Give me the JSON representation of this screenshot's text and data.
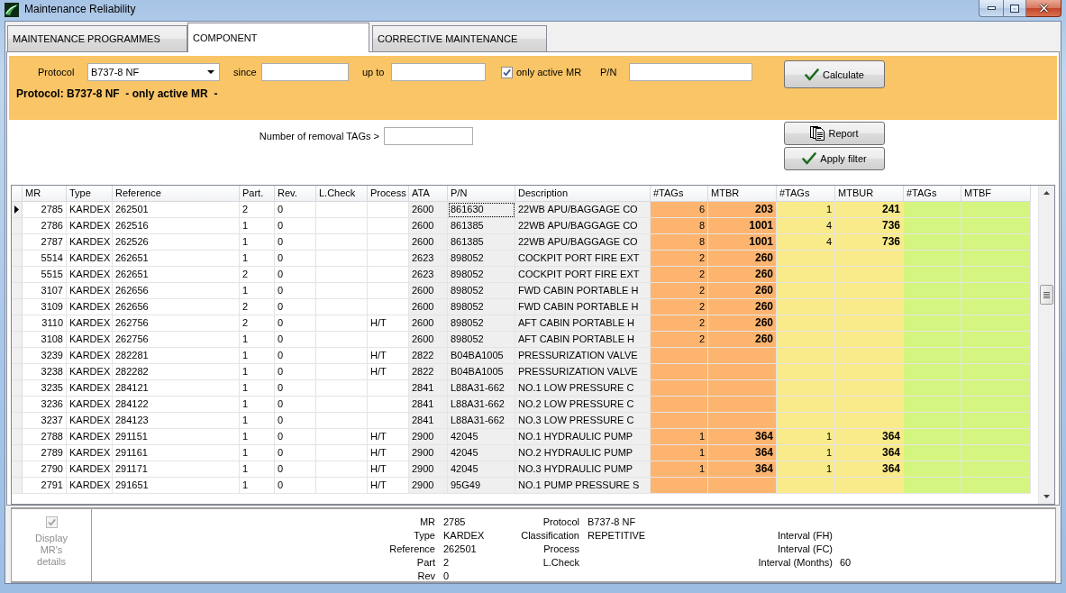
{
  "window": {
    "title": "Maintenance Reliability"
  },
  "tabs": [
    {
      "label": "MAINTENANCE PROGRAMMES",
      "selected": false
    },
    {
      "label": "COMPONENT",
      "selected": true
    },
    {
      "label": "CORRECTIVE MAINTENANCE",
      "selected": false
    }
  ],
  "filters": {
    "protocol": {
      "label": "Protocol",
      "value": "B737-8 NF"
    },
    "since": {
      "label": "since"
    },
    "up_to": {
      "label": "up to"
    },
    "only_active_mr": {
      "label": "only active MR",
      "checked": true
    },
    "part_number": {
      "label": "P/N"
    },
    "calculate": {
      "label": "Calculate",
      "kind": "confirm"
    },
    "summary": "Protocol: B737-8 NF  - only active MR  -"
  },
  "removal_tags": {
    "label": "Number of removal TAGs >"
  },
  "actions": [
    {
      "label": "Report",
      "kind": "report"
    },
    {
      "label": "Apply filter",
      "kind": "confirm"
    }
  ],
  "table": {
    "columns": [
      {
        "label": "MR",
        "kind": "count",
        "current": false
      },
      {
        "label": "Type",
        "kind": "text",
        "current": false
      },
      {
        "label": "Reference",
        "kind": "text",
        "current": false
      },
      {
        "label": "Part.",
        "kind": "text",
        "current": false
      },
      {
        "label": "Rev.",
        "kind": "text",
        "current": false
      },
      {
        "label": "L.Check",
        "kind": "text",
        "current": false
      },
      {
        "label": "Process",
        "kind": "text",
        "current": false
      },
      {
        "label": "ATA",
        "kind": "text",
        "current": false,
        "color": "#efefef"
      },
      {
        "label": "P/N",
        "kind": "text",
        "current": true,
        "color": "#efefef"
      },
      {
        "label": "Description",
        "kind": "text",
        "current": false,
        "color": "#efefef"
      },
      {
        "label": "#TAGs",
        "kind": "count",
        "current": false,
        "color": "#fdb46f"
      },
      {
        "label": "MTBR",
        "kind": "mtb",
        "current": false,
        "color": "#fdb46f"
      },
      {
        "label": "#TAGs",
        "kind": "count",
        "current": false,
        "color": "#f9eb89"
      },
      {
        "label": "MTBUR",
        "kind": "mtb",
        "current": false,
        "color": "#f9eb89"
      },
      {
        "label": "#TAGs",
        "kind": "count",
        "current": false,
        "color": "#d4f57f"
      },
      {
        "label": "MTBF",
        "kind": "mtb",
        "current": false,
        "color": "#d4f57f"
      }
    ],
    "rows": [
      {
        "selected": true,
        "mr": "2785",
        "type": "KARDEX",
        "reference": "262501",
        "part": "2",
        "rev": "0",
        "ata": "2600",
        "pn": "861630",
        "description": "22WB APU/BAGGAGE CO",
        "tags_r": "6",
        "mtbr": "203",
        "tags_ur": "1",
        "mtbur": "241"
      },
      {
        "selected": false,
        "mr": "2786",
        "type": "KARDEX",
        "reference": "262516",
        "part": "1",
        "rev": "0",
        "ata": "2600",
        "pn": "861385",
        "description": "22WB APU/BAGGAGE CO",
        "tags_r": "8",
        "mtbr": "1001",
        "tags_ur": "4",
        "mtbur": "736"
      },
      {
        "selected": false,
        "mr": "2787",
        "type": "KARDEX",
        "reference": "262526",
        "part": "1",
        "rev": "0",
        "ata": "2600",
        "pn": "861385",
        "description": "22WB APU/BAGGAGE CO",
        "tags_r": "8",
        "mtbr": "1001",
        "tags_ur": "4",
        "mtbur": "736"
      },
      {
        "selected": false,
        "mr": "5514",
        "type": "KARDEX",
        "reference": "262651",
        "part": "1",
        "rev": "0",
        "ata": "2623",
        "pn": "898052",
        "description": "COCKPIT PORT FIRE EXT",
        "tags_r": "2",
        "mtbr": "260"
      },
      {
        "selected": false,
        "mr": "5515",
        "type": "KARDEX",
        "reference": "262651",
        "part": "2",
        "rev": "0",
        "ata": "2623",
        "pn": "898052",
        "description": "COCKPIT PORT FIRE EXT",
        "tags_r": "2",
        "mtbr": "260"
      },
      {
        "selected": false,
        "mr": "3107",
        "type": "KARDEX",
        "reference": "262656",
        "part": "1",
        "rev": "0",
        "ata": "2600",
        "pn": "898052",
        "description": "FWD CABIN PORTABLE H",
        "tags_r": "2",
        "mtbr": "260"
      },
      {
        "selected": false,
        "mr": "3109",
        "type": "KARDEX",
        "reference": "262656",
        "part": "2",
        "rev": "0",
        "ata": "2600",
        "pn": "898052",
        "description": "FWD CABIN PORTABLE H",
        "tags_r": "2",
        "mtbr": "260"
      },
      {
        "selected": false,
        "mr": "3110",
        "type": "KARDEX",
        "reference": "262756",
        "part": "2",
        "rev": "0",
        "process": "H/T",
        "ata": "2600",
        "pn": "898052",
        "description": "AFT CABIN PORTABLE H",
        "tags_r": "2",
        "mtbr": "260"
      },
      {
        "selected": false,
        "mr": "3108",
        "type": "KARDEX",
        "reference": "262756",
        "part": "1",
        "rev": "0",
        "ata": "2600",
        "pn": "898052",
        "description": "AFT CABIN PORTABLE H",
        "tags_r": "2",
        "mtbr": "260"
      },
      {
        "selected": false,
        "mr": "3239",
        "type": "KARDEX",
        "reference": "282281",
        "part": "1",
        "rev": "0",
        "process": "H/T",
        "ata": "2822",
        "pn": "B04BA1005",
        "description": "PRESSURIZATION VALVE"
      },
      {
        "selected": false,
        "mr": "3238",
        "type": "KARDEX",
        "reference": "282282",
        "part": "1",
        "rev": "0",
        "process": "H/T",
        "ata": "2822",
        "pn": "B04BA1005",
        "description": "PRESSURIZATION VALVE"
      },
      {
        "selected": false,
        "mr": "3235",
        "type": "KARDEX",
        "reference": "284121",
        "part": "1",
        "rev": "0",
        "ata": "2841",
        "pn": "L88A31-662",
        "description": "NO.1 LOW PRESSURE C"
      },
      {
        "selected": false,
        "mr": "3236",
        "type": "KARDEX",
        "reference": "284122",
        "part": "1",
        "rev": "0",
        "ata": "2841",
        "pn": "L88A31-662",
        "description": "NO.2 LOW PRESSURE C"
      },
      {
        "selected": false,
        "mr": "3237",
        "type": "KARDEX",
        "reference": "284123",
        "part": "1",
        "rev": "0",
        "ata": "2841",
        "pn": "L88A31-662",
        "description": "NO.3 LOW PRESSURE C"
      },
      {
        "selected": false,
        "mr": "2788",
        "type": "KARDEX",
        "reference": "291151",
        "part": "1",
        "rev": "0",
        "process": "H/T",
        "ata": "2900",
        "pn": "42045",
        "description": "NO.1 HYDRAULIC PUMP",
        "tags_r": "1",
        "mtbr": "364",
        "tags_ur": "1",
        "mtbur": "364"
      },
      {
        "selected": false,
        "mr": "2789",
        "type": "KARDEX",
        "reference": "291161",
        "part": "1",
        "rev": "0",
        "process": "H/T",
        "ata": "2900",
        "pn": "42045",
        "description": "NO.2 HYDRAULIC PUMP",
        "tags_r": "1",
        "mtbr": "364",
        "tags_ur": "1",
        "mtbur": "364"
      },
      {
        "selected": false,
        "mr": "2790",
        "type": "KARDEX",
        "reference": "291171",
        "part": "1",
        "rev": "0",
        "process": "H/T",
        "ata": "2900",
        "pn": "42045",
        "description": "NO.3 HYDRAULIC PUMP",
        "tags_r": "1",
        "mtbr": "364",
        "tags_ur": "1",
        "mtbur": "364"
      },
      {
        "selected": false,
        "mr": "2791",
        "type": "KARDEX",
        "reference": "291651",
        "part": "1",
        "rev": "0",
        "process": "H/T",
        "ata": "2900",
        "pn": "95G49",
        "description": "NO.1 PUMP PRESSURE S"
      }
    ]
  },
  "details": {
    "display_mr_details": {
      "label": "Display MR's details",
      "checked": true,
      "disabled": true
    },
    "groups": [
      {
        "fields": [
          {
            "label": "MR",
            "value": "2785"
          },
          {
            "label": "Type",
            "value": "KARDEX"
          },
          {
            "label": "Reference",
            "value": "262501"
          },
          {
            "label": "Part",
            "value": "2"
          },
          {
            "label": "Rev",
            "value": "0"
          }
        ]
      },
      {
        "fields": [
          {
            "label": "Protocol",
            "value": "B737-8 NF"
          },
          {
            "label": "Classification",
            "value": "REPETITIVE"
          },
          {
            "label": "Process"
          },
          {
            "label": "L.Check"
          }
        ]
      },
      {
        "fields": [
          {
            "label": "Interval (FH)"
          },
          {
            "label": "Interval (FC)"
          },
          {
            "label": "Interval (Months)",
            "value": "60"
          }
        ]
      }
    ]
  }
}
